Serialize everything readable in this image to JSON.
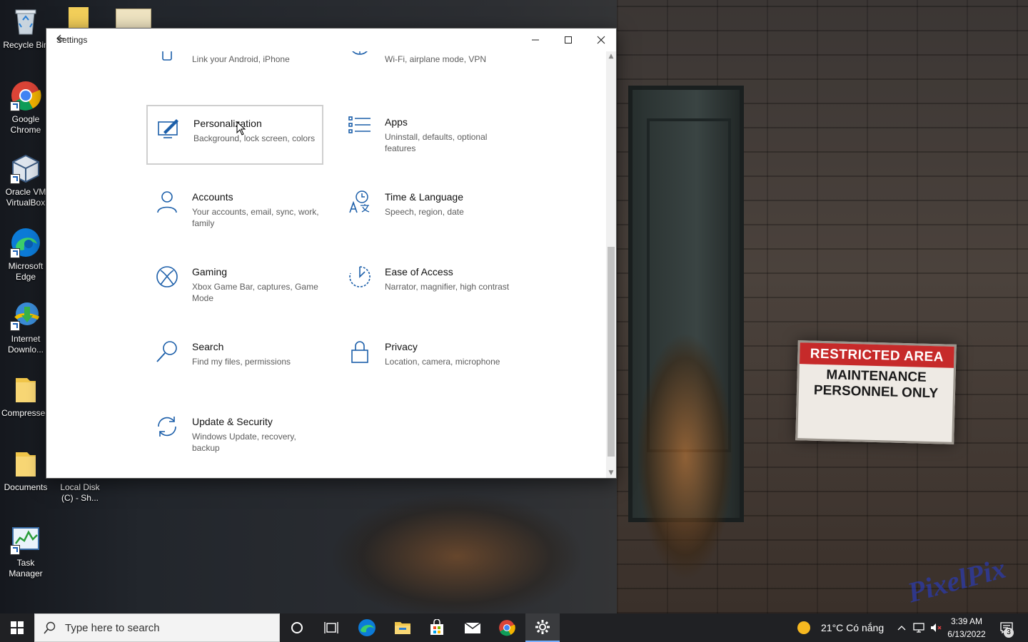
{
  "desktop": {
    "icons": [
      {
        "label": "Recycle Bin"
      },
      {
        "label": "Google Chrome"
      },
      {
        "label": "Oracle VM VirtualBox"
      },
      {
        "label": "Microsoft Edge"
      },
      {
        "label": "Internet Downlo..."
      },
      {
        "label": "Compressed"
      },
      {
        "label": "Documents"
      },
      {
        "label": "Local Disk (C) - Sh..."
      },
      {
        "label": "Task Manager"
      }
    ]
  },
  "wallpaper": {
    "sign_top": "RESTRICTED AREA",
    "sign_bottom": "MAINTENANCE PERSONNEL ONLY",
    "wall_text": "PixelPix"
  },
  "window": {
    "title": "Settings",
    "minimize_icon": "minimize-icon",
    "maximize_icon": "maximize-icon",
    "close_icon": "close-icon",
    "tiles": [
      {
        "name": "",
        "desc": "Link your Android, iPhone",
        "icon": "phone-icon"
      },
      {
        "name": "",
        "desc": "Wi-Fi, airplane mode, VPN",
        "icon": "globe-icon"
      },
      {
        "name": "Personalization",
        "desc": "Background, lock screen, colors",
        "icon": "personalization-icon"
      },
      {
        "name": "Apps",
        "desc": "Uninstall, defaults, optional features",
        "icon": "apps-icon"
      },
      {
        "name": "Accounts",
        "desc": "Your accounts, email, sync, work, family",
        "icon": "person-icon"
      },
      {
        "name": "Time & Language",
        "desc": "Speech, region, date",
        "icon": "time-language-icon"
      },
      {
        "name": "Gaming",
        "desc": "Xbox Game Bar, captures, Game Mode",
        "icon": "xbox-icon"
      },
      {
        "name": "Ease of Access",
        "desc": "Narrator, magnifier, high contrast",
        "icon": "ease-of-access-icon"
      },
      {
        "name": "Search",
        "desc": "Find my files, permissions",
        "icon": "search-icon"
      },
      {
        "name": "Privacy",
        "desc": "Location, camera, microphone",
        "icon": "lock-icon"
      },
      {
        "name": "Update & Security",
        "desc": "Windows Update, recovery, backup",
        "icon": "update-icon"
      }
    ]
  },
  "taskbar": {
    "search_placeholder": "Type here to search",
    "weather": "21°C  Có nắng",
    "time": "3:39 AM",
    "date": "6/13/2022",
    "notification_count": "3"
  }
}
